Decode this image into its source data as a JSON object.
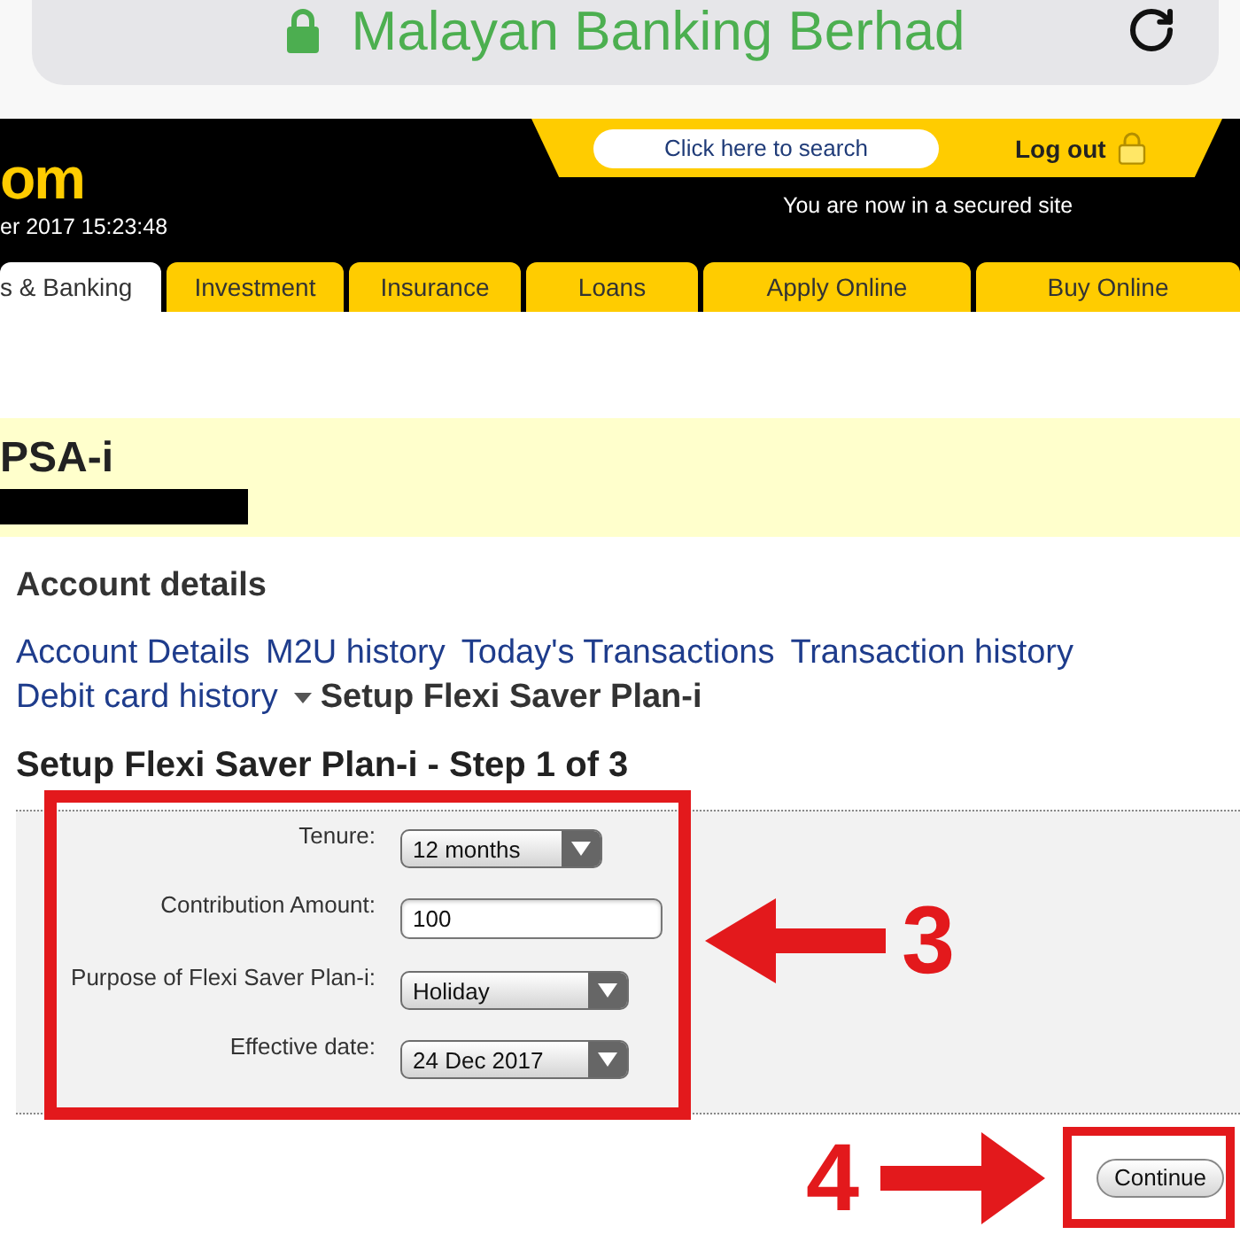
{
  "browser": {
    "address": "Malayan Banking Berhad"
  },
  "header": {
    "logo_fragment": "om",
    "datetime": "er 2017 15:23:48",
    "search_button": "Click here to search",
    "logout": "Log out",
    "secure_note": "You are now in a secured site"
  },
  "tabs": [
    {
      "label": "s & Banking",
      "selected": true
    },
    {
      "label": "Investment",
      "selected": false
    },
    {
      "label": "Insurance",
      "selected": false
    },
    {
      "label": "Loans",
      "selected": false
    },
    {
      "label": "Apply Online",
      "selected": false
    },
    {
      "label": "Buy Online",
      "selected": false
    }
  ],
  "account": {
    "name": "PSA-i"
  },
  "section_title": "Account details",
  "links": [
    {
      "label": "Account Details",
      "selected": false
    },
    {
      "label": "M2U history",
      "selected": false
    },
    {
      "label": "Today's Transactions",
      "selected": false
    },
    {
      "label": "Transaction history",
      "selected": false
    },
    {
      "label": "Debit card history",
      "selected": false
    },
    {
      "label": "Setup Flexi Saver Plan-i",
      "selected": true
    }
  ],
  "form": {
    "title": "Setup Flexi Saver Plan-i - Step 1 of 3",
    "fields": [
      {
        "label": "Tenure:",
        "kind": "select",
        "value": "12 months"
      },
      {
        "label": "Contribution Amount:",
        "kind": "text",
        "value": "100"
      },
      {
        "label": "Purpose of Flexi Saver Plan-i:",
        "kind": "select",
        "value": "Holiday"
      },
      {
        "label": "Effective date:",
        "kind": "select",
        "value": "24 Dec 2017"
      }
    ],
    "continue_button": "Continue"
  },
  "annotations": [
    {
      "kind": "fields-callout",
      "number": "3"
    },
    {
      "kind": "button-callout",
      "number": "4"
    }
  ]
}
